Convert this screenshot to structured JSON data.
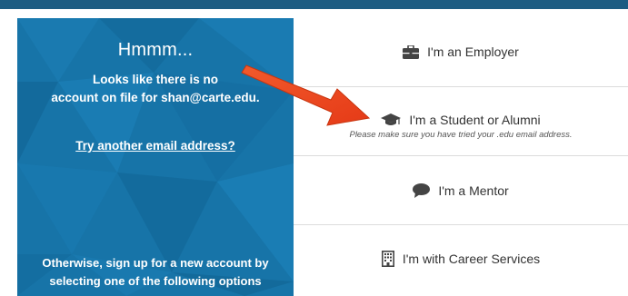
{
  "left": {
    "title": "Hmmm...",
    "message_line1": "Looks like there is no",
    "message_line2_prefix": "account on file for ",
    "message_email": "shan@carte.edu",
    "message_line2_suffix": ".",
    "link": "Try another email address?",
    "footer_line1": "Otherwise, sign up for a new account by",
    "footer_line2": "selecting one of the following options"
  },
  "options": [
    {
      "label": "I'm an Employer",
      "icon": "briefcase-icon"
    },
    {
      "label": "I'm a Student or Alumni",
      "icon": "graduation-cap-icon",
      "hint": "Please make sure you have tried your .edu email address."
    },
    {
      "label": "I'm a Mentor",
      "icon": "speech-bubble-icon"
    },
    {
      "label": "I'm with Career Services",
      "icon": "building-icon"
    }
  ],
  "colors": {
    "panel_blue": "#1774a8",
    "topbar": "#1d5c82",
    "arrow": "#e8401c"
  }
}
